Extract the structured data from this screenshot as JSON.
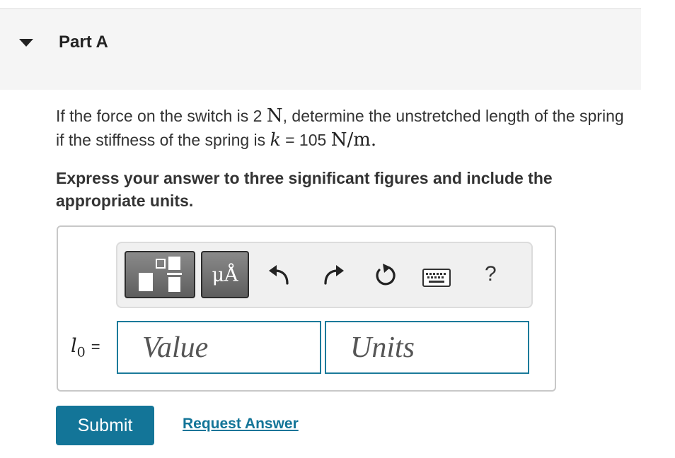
{
  "part": {
    "title": "Part A",
    "toggle_icon": "caret-down-icon"
  },
  "question": {
    "text_1": "If the force on the switch is 2 ",
    "force_unit": "N",
    "text_2": ", determine the unstretched length of the spring if the stiffness of the spring is ",
    "k_symbol": "k",
    "text_3": " = 105 ",
    "k_unit": "N/m",
    "text_4": "."
  },
  "instruction": "Express your answer to three significant figures and include the appropriate units.",
  "toolbar": {
    "templates_icon": "fraction-templates-icon",
    "units_label": "μÅ",
    "undo_icon": "undo-icon",
    "redo_icon": "redo-icon",
    "reset_icon": "reset-icon",
    "keyboard_icon": "keyboard-icon",
    "help_label": "?"
  },
  "answer": {
    "variable_symbol": "l",
    "variable_subscript": "0",
    "equals": "=",
    "value_placeholder": "Value",
    "units_placeholder": "Units"
  },
  "actions": {
    "submit_label": "Submit",
    "request_label": "Request Answer"
  },
  "colors": {
    "accent": "#137598",
    "input_border": "#1b7a9a",
    "header_bg": "#f5f5f5",
    "toolbar_bg": "#f0f0f0"
  }
}
